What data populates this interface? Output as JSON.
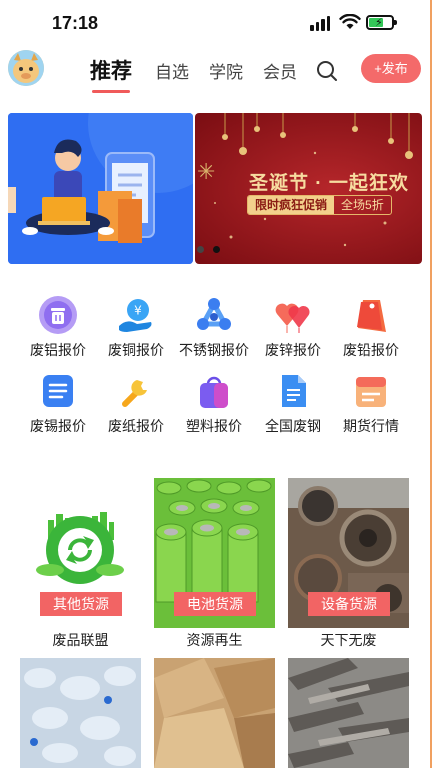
{
  "status_bar": {
    "time": "17:18"
  },
  "nav": {
    "tabs": [
      {
        "label": "推荐",
        "active": true
      },
      {
        "label": "自选",
        "active": false
      },
      {
        "label": "学院",
        "active": false
      },
      {
        "label": "会员",
        "active": false
      }
    ],
    "publish_label": "+发布",
    "icons": [
      "avatar",
      "search-icon"
    ]
  },
  "banner": {
    "slide2_title": "圣诞节 · 一起狂欢",
    "slide2_tag_left": "限时疯狂促销",
    "slide2_tag_right": "全场5折"
  },
  "categories": [
    {
      "label": "废铝报价",
      "icon": "trash-icon",
      "color": "#9b7bf0"
    },
    {
      "label": "废铜报价",
      "icon": "yuan-hand-icon",
      "color": "#2f9ef5"
    },
    {
      "label": "不锈钢报价",
      "icon": "spinner-icon",
      "color": "#3b8ef0"
    },
    {
      "label": "废锌报价",
      "icon": "hearts-icon",
      "color": "#f05a5a"
    },
    {
      "label": "废铅报价",
      "icon": "tag-icon",
      "color": "#f0503c"
    },
    {
      "label": "废锡报价",
      "icon": "list-icon",
      "color": "#3a7cf2"
    },
    {
      "label": "废纸报价",
      "icon": "wrench-icon",
      "color": "#f5b52e"
    },
    {
      "label": "塑料报价",
      "icon": "bag-icon",
      "color": "#7a5cf0"
    },
    {
      "label": "全国废钢",
      "icon": "document-icon",
      "color": "#3a8cf2"
    },
    {
      "label": "期货行情",
      "icon": "calendar-icon",
      "color": "#f47a5a"
    }
  ],
  "cards": [
    {
      "badge": "其他货源",
      "caption": "废品联盟"
    },
    {
      "badge": "电池货源",
      "caption": "资源再生"
    },
    {
      "badge": "设备货源",
      "caption": "天下无废"
    }
  ]
}
